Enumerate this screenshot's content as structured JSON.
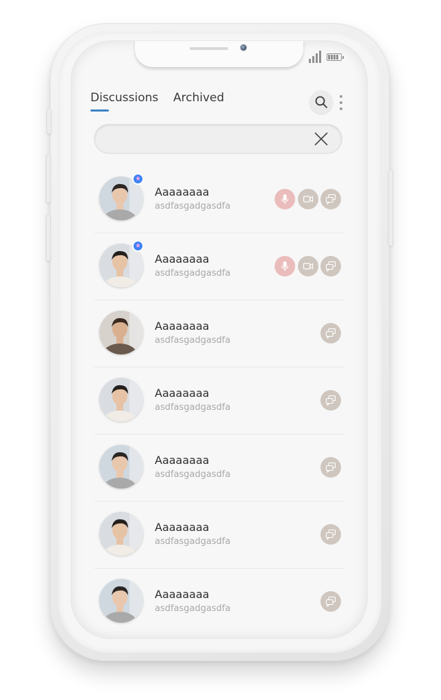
{
  "header": {
    "tabs": [
      {
        "label": "Discussions",
        "active": true
      },
      {
        "label": "Archived",
        "active": false
      }
    ]
  },
  "search": {
    "value": "",
    "placeholder": ""
  },
  "colors": {
    "accent": "#3b82c4",
    "mic_button": "#ebbcbc",
    "action_button": "#cfc7bf",
    "favorite_badge": "#3b82f6"
  },
  "contacts": [
    {
      "name": "Aaaaaaaa",
      "message": "asdfasgadgasdfa",
      "favorite": true,
      "actions": [
        "mic-icon",
        "video-icon",
        "chat-icon"
      ]
    },
    {
      "name": "Aaaaaaaa",
      "message": "asdfasgadgasdfa",
      "favorite": true,
      "actions": [
        "mic-icon",
        "video-icon",
        "chat-icon"
      ]
    },
    {
      "name": "Aaaaaaaa",
      "message": "asdfasgadgasdfa",
      "favorite": false,
      "actions": [
        "chat-icon"
      ]
    },
    {
      "name": "Aaaaaaaa",
      "message": "asdfasgadgasdfa",
      "favorite": false,
      "actions": [
        "chat-icon"
      ]
    },
    {
      "name": "Aaaaaaaa",
      "message": "asdfasgadgasdfa",
      "favorite": false,
      "actions": [
        "chat-icon"
      ]
    },
    {
      "name": "Aaaaaaaa",
      "message": "asdfasgadgasdfa",
      "favorite": false,
      "actions": [
        "chat-icon"
      ]
    },
    {
      "name": "Aaaaaaaa",
      "message": "asdfasgadgasdfa",
      "favorite": false,
      "actions": [
        "chat-icon"
      ]
    }
  ]
}
